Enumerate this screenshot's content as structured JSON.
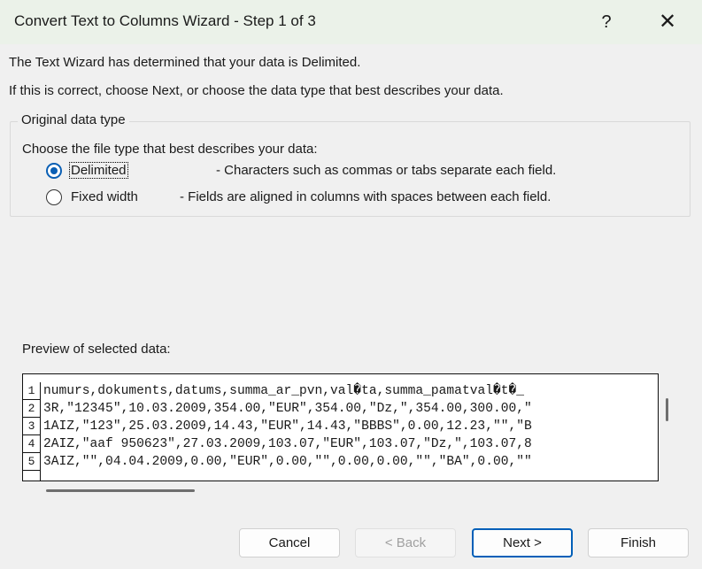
{
  "window": {
    "title": "Convert Text to Columns Wizard - Step 1 of 3",
    "help_label": "?",
    "close_label": "✕"
  },
  "message": {
    "line1": "The Text Wizard has determined that your data is Delimited.",
    "line2": "If this is correct, choose Next, or choose the data type that best describes your data."
  },
  "original_data_type": {
    "legend": "Original data type",
    "prompt": "Choose the file type that best describes your data:",
    "options": [
      {
        "label": "Delimited",
        "description": "- Characters such as commas or tabs separate each field.",
        "selected": true
      },
      {
        "label": "Fixed width",
        "description": "- Fields are aligned in columns with spaces between each field.",
        "selected": false
      }
    ]
  },
  "preview": {
    "label": "Preview of selected data:",
    "rows": [
      {
        "num": "1",
        "text": "numurs,dokuments,datums,summa_ar_pvn,val�ta,summa_pamatval�t�_"
      },
      {
        "num": "2",
        "text": "3R,\"12345\",10.03.2009,354.00,\"EUR\",354.00,\"Dz,\",354.00,300.00,\""
      },
      {
        "num": "3",
        "text": "1AIZ,\"123\",25.03.2009,14.43,\"EUR\",14.43,\"BBBS\",0.00,12.23,\"\",\"B"
      },
      {
        "num": "4",
        "text": "2AIZ,\"aaf 950623\",27.03.2009,103.07,\"EUR\",103.07,\"Dz,\",103.07,8"
      },
      {
        "num": "5",
        "text": "3AIZ,\"\",04.04.2009,0.00,\"EUR\",0.00,\"\",0.00,0.00,\"\",\"BA\",0.00,\"\""
      }
    ]
  },
  "buttons": {
    "cancel": "Cancel",
    "back": "< Back",
    "next": "Next >",
    "finish": "Finish"
  }
}
